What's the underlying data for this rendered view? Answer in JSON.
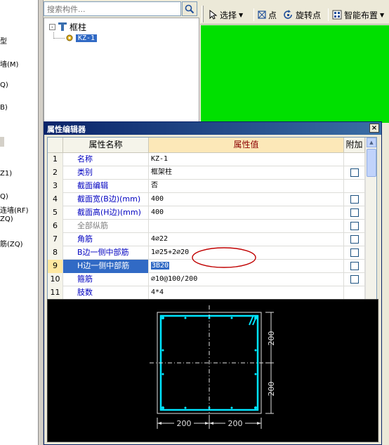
{
  "left_tree": {
    "items": [
      "型",
      "墙(M)",
      "Q)",
      "B)",
      "Z1)",
      "Q)",
      "连墙(RF)",
      "ZQ)",
      "筋(ZQ)"
    ]
  },
  "search": {
    "placeholder": "搜索构件..."
  },
  "tree": {
    "root_label": "框柱",
    "child_label": "KZ-1",
    "expander": "-"
  },
  "toolbar": {
    "select_label": "选择",
    "point_label": "点",
    "rotate_point_label": "旋转点",
    "smart_layout_label": "智能布置"
  },
  "property_editor": {
    "title": "属性编辑器",
    "close_glyph": "×",
    "headers": {
      "number": "",
      "name": "属性名称",
      "value": "属性值",
      "attach": "附加"
    },
    "rows": [
      {
        "no": "1",
        "name": "名称",
        "value": "KZ-1",
        "check": false,
        "style": "blue"
      },
      {
        "no": "2",
        "name": "类别",
        "value": "框架柱",
        "check": true,
        "style": "blue"
      },
      {
        "no": "3",
        "name": "截面编辑",
        "value": "否",
        "check": false,
        "style": "blue"
      },
      {
        "no": "4",
        "name": "截面宽(B边)(mm)",
        "value": "400",
        "check": true,
        "style": "blue"
      },
      {
        "no": "5",
        "name": "截面高(H边)(mm)",
        "value": "400",
        "check": true,
        "style": "blue"
      },
      {
        "no": "6",
        "name": "全部纵筋",
        "value": "",
        "check": true,
        "style": "gray"
      },
      {
        "no": "7",
        "name": "角筋",
        "value": "4⌀22",
        "check": true,
        "style": "blue"
      },
      {
        "no": "8",
        "name": "B边一侧中部筋",
        "value": "1⌀25+2⌀20",
        "check": true,
        "style": "blue"
      },
      {
        "no": "9",
        "name": "H边一侧中部筋",
        "value": "3B20",
        "check": true,
        "style": "selected"
      },
      {
        "no": "10",
        "name": "箍筋",
        "value": "⌀10@100/200",
        "check": true,
        "style": "blue"
      },
      {
        "no": "11",
        "name": "肢数",
        "value": "4*4",
        "check": false,
        "style": "blue"
      }
    ],
    "ellipsis": "..."
  },
  "preview": {
    "dim_top": "200",
    "dim_bottom": "200",
    "dim_horizontal_left": "200",
    "dim_horizontal_right": "200"
  },
  "colors": {
    "canvas_green": "#00E000",
    "rebar_cyan": "#00E5FF",
    "annotation_red": "#C00000",
    "selection_blue": "#316AC5"
  }
}
